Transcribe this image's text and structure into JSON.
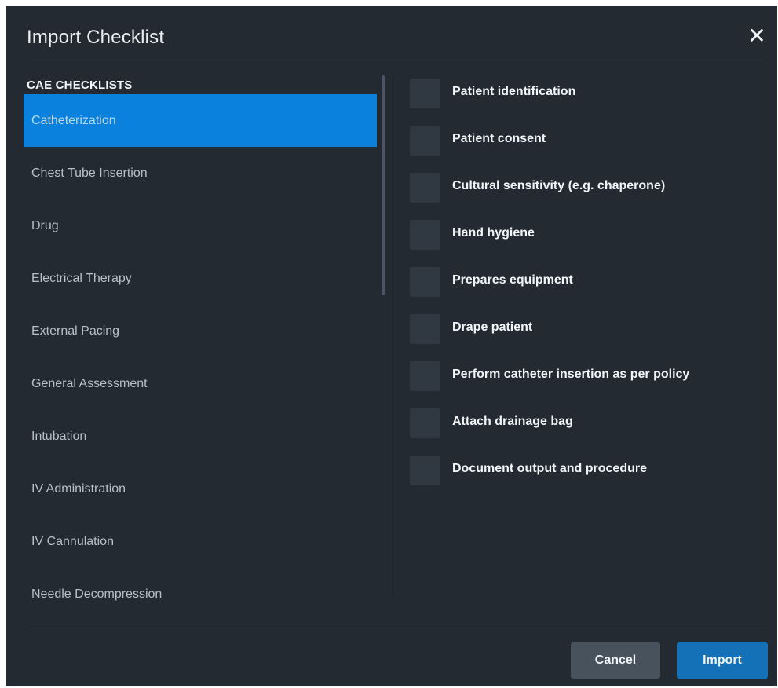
{
  "dialog": {
    "title": "Import Checklist",
    "close_icon": "close-icon",
    "close_glyph": "✕"
  },
  "left": {
    "section_title": "CAE CHECKLISTS",
    "items": [
      {
        "label": "Catheterization",
        "selected": true
      },
      {
        "label": "Chest Tube Insertion"
      },
      {
        "label": "Drug"
      },
      {
        "label": "Electrical Therapy"
      },
      {
        "label": "External Pacing"
      },
      {
        "label": "General Assessment"
      },
      {
        "label": "Intubation"
      },
      {
        "label": "IV Administration"
      },
      {
        "label": "IV Cannulation"
      },
      {
        "label": "Needle Decompression"
      }
    ]
  },
  "right": {
    "items": [
      {
        "label": "Patient identification",
        "checked": false
      },
      {
        "label": "Patient consent",
        "checked": false
      },
      {
        "label": "Cultural sensitivity (e.g. chaperone)",
        "checked": false
      },
      {
        "label": "Hand hygiene",
        "checked": false
      },
      {
        "label": "Prepares equipment",
        "checked": false
      },
      {
        "label": "Drape patient",
        "checked": false
      },
      {
        "label": "Perform catheter insertion as per policy",
        "checked": false
      },
      {
        "label": "Attach drainage bag",
        "checked": false
      },
      {
        "label": "Document output and procedure",
        "checked": false
      }
    ]
  },
  "footer": {
    "cancel_label": "Cancel",
    "import_label": "Import"
  },
  "colors": {
    "background": "#232a32",
    "selected": "#0a82dd",
    "import_button": "#1471b7",
    "cancel_button": "#48525c"
  }
}
